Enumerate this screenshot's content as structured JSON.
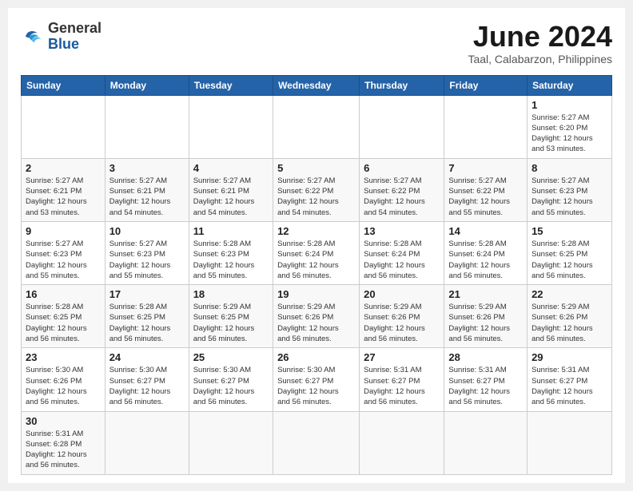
{
  "header": {
    "logo_general": "General",
    "logo_blue": "Blue",
    "month": "June 2024",
    "location": "Taal, Calabarzon, Philippines"
  },
  "days_of_week": [
    "Sunday",
    "Monday",
    "Tuesday",
    "Wednesday",
    "Thursday",
    "Friday",
    "Saturday"
  ],
  "weeks": [
    [
      {
        "day": "",
        "info": ""
      },
      {
        "day": "",
        "info": ""
      },
      {
        "day": "",
        "info": ""
      },
      {
        "day": "",
        "info": ""
      },
      {
        "day": "",
        "info": ""
      },
      {
        "day": "",
        "info": ""
      },
      {
        "day": "1",
        "info": "Sunrise: 5:27 AM\nSunset: 6:20 PM\nDaylight: 12 hours\nand 53 minutes."
      }
    ],
    [
      {
        "day": "2",
        "info": "Sunrise: 5:27 AM\nSunset: 6:21 PM\nDaylight: 12 hours\nand 53 minutes."
      },
      {
        "day": "3",
        "info": "Sunrise: 5:27 AM\nSunset: 6:21 PM\nDaylight: 12 hours\nand 54 minutes."
      },
      {
        "day": "4",
        "info": "Sunrise: 5:27 AM\nSunset: 6:21 PM\nDaylight: 12 hours\nand 54 minutes."
      },
      {
        "day": "5",
        "info": "Sunrise: 5:27 AM\nSunset: 6:22 PM\nDaylight: 12 hours\nand 54 minutes."
      },
      {
        "day": "6",
        "info": "Sunrise: 5:27 AM\nSunset: 6:22 PM\nDaylight: 12 hours\nand 54 minutes."
      },
      {
        "day": "7",
        "info": "Sunrise: 5:27 AM\nSunset: 6:22 PM\nDaylight: 12 hours\nand 55 minutes."
      },
      {
        "day": "8",
        "info": "Sunrise: 5:27 AM\nSunset: 6:23 PM\nDaylight: 12 hours\nand 55 minutes."
      }
    ],
    [
      {
        "day": "9",
        "info": "Sunrise: 5:27 AM\nSunset: 6:23 PM\nDaylight: 12 hours\nand 55 minutes."
      },
      {
        "day": "10",
        "info": "Sunrise: 5:27 AM\nSunset: 6:23 PM\nDaylight: 12 hours\nand 55 minutes."
      },
      {
        "day": "11",
        "info": "Sunrise: 5:28 AM\nSunset: 6:23 PM\nDaylight: 12 hours\nand 55 minutes."
      },
      {
        "day": "12",
        "info": "Sunrise: 5:28 AM\nSunset: 6:24 PM\nDaylight: 12 hours\nand 56 minutes."
      },
      {
        "day": "13",
        "info": "Sunrise: 5:28 AM\nSunset: 6:24 PM\nDaylight: 12 hours\nand 56 minutes."
      },
      {
        "day": "14",
        "info": "Sunrise: 5:28 AM\nSunset: 6:24 PM\nDaylight: 12 hours\nand 56 minutes."
      },
      {
        "day": "15",
        "info": "Sunrise: 5:28 AM\nSunset: 6:25 PM\nDaylight: 12 hours\nand 56 minutes."
      }
    ],
    [
      {
        "day": "16",
        "info": "Sunrise: 5:28 AM\nSunset: 6:25 PM\nDaylight: 12 hours\nand 56 minutes."
      },
      {
        "day": "17",
        "info": "Sunrise: 5:28 AM\nSunset: 6:25 PM\nDaylight: 12 hours\nand 56 minutes."
      },
      {
        "day": "18",
        "info": "Sunrise: 5:29 AM\nSunset: 6:25 PM\nDaylight: 12 hours\nand 56 minutes."
      },
      {
        "day": "19",
        "info": "Sunrise: 5:29 AM\nSunset: 6:26 PM\nDaylight: 12 hours\nand 56 minutes."
      },
      {
        "day": "20",
        "info": "Sunrise: 5:29 AM\nSunset: 6:26 PM\nDaylight: 12 hours\nand 56 minutes."
      },
      {
        "day": "21",
        "info": "Sunrise: 5:29 AM\nSunset: 6:26 PM\nDaylight: 12 hours\nand 56 minutes."
      },
      {
        "day": "22",
        "info": "Sunrise: 5:29 AM\nSunset: 6:26 PM\nDaylight: 12 hours\nand 56 minutes."
      }
    ],
    [
      {
        "day": "23",
        "info": "Sunrise: 5:30 AM\nSunset: 6:26 PM\nDaylight: 12 hours\nand 56 minutes."
      },
      {
        "day": "24",
        "info": "Sunrise: 5:30 AM\nSunset: 6:27 PM\nDaylight: 12 hours\nand 56 minutes."
      },
      {
        "day": "25",
        "info": "Sunrise: 5:30 AM\nSunset: 6:27 PM\nDaylight: 12 hours\nand 56 minutes."
      },
      {
        "day": "26",
        "info": "Sunrise: 5:30 AM\nSunset: 6:27 PM\nDaylight: 12 hours\nand 56 minutes."
      },
      {
        "day": "27",
        "info": "Sunrise: 5:31 AM\nSunset: 6:27 PM\nDaylight: 12 hours\nand 56 minutes."
      },
      {
        "day": "28",
        "info": "Sunrise: 5:31 AM\nSunset: 6:27 PM\nDaylight: 12 hours\nand 56 minutes."
      },
      {
        "day": "29",
        "info": "Sunrise: 5:31 AM\nSunset: 6:27 PM\nDaylight: 12 hours\nand 56 minutes."
      }
    ],
    [
      {
        "day": "30",
        "info": "Sunrise: 5:31 AM\nSunset: 6:28 PM\nDaylight: 12 hours\nand 56 minutes."
      },
      {
        "day": "",
        "info": ""
      },
      {
        "day": "",
        "info": ""
      },
      {
        "day": "",
        "info": ""
      },
      {
        "day": "",
        "info": ""
      },
      {
        "day": "",
        "info": ""
      },
      {
        "day": "",
        "info": ""
      }
    ]
  ]
}
